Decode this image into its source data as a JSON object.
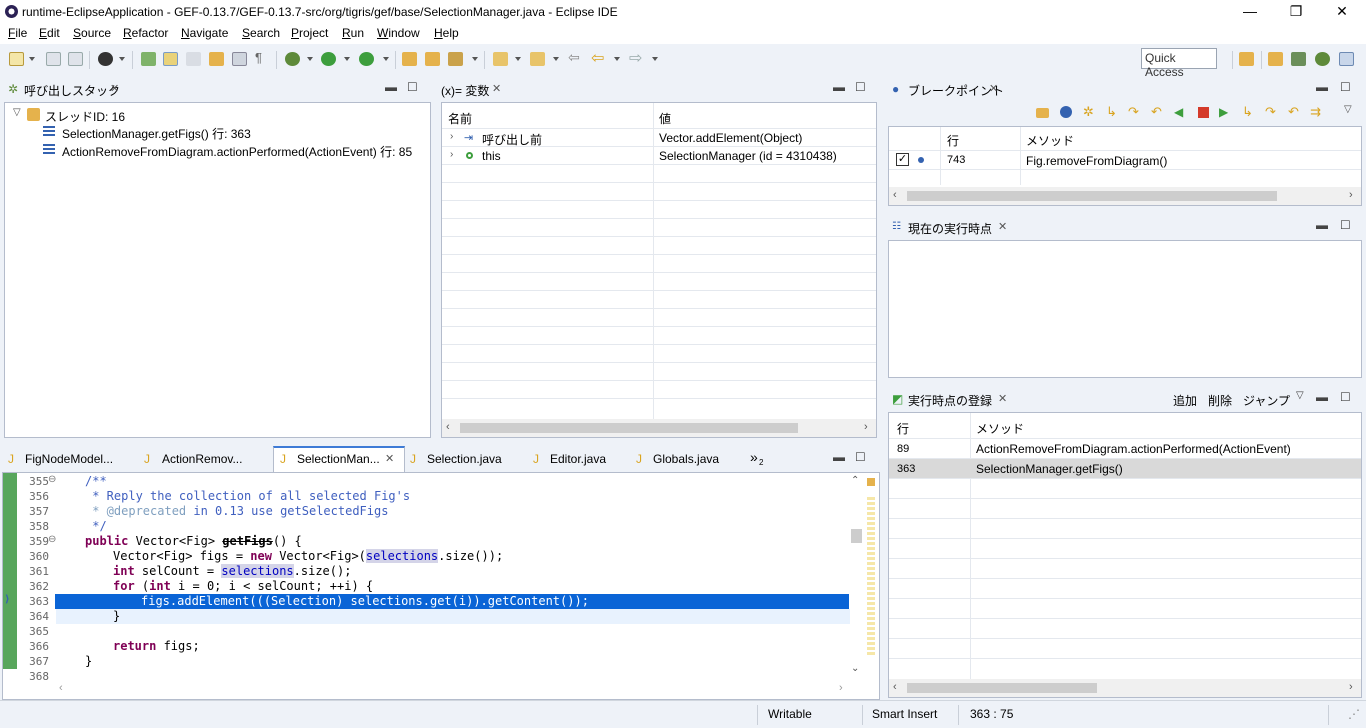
{
  "window": {
    "title": "runtime-EclipseApplication - GEF-0.13.7/GEF-0.13.7-src/org/tigris/gef/base/SelectionManager.java - Eclipse IDE",
    "minimize": "—",
    "restore": "❐",
    "close": "✕"
  },
  "menu": [
    "File",
    "Edit",
    "Source",
    "Refactor",
    "Navigate",
    "Search",
    "Project",
    "Run",
    "Window",
    "Help"
  ],
  "quick_access": "Quick Access",
  "callstack": {
    "tab": "呼び出しスタック",
    "thread": "スレッドID: 16",
    "frames": [
      "SelectionManager.getFigs() 行: 363",
      "ActionRemoveFromDiagram.actionPerformed(ActionEvent) 行: 85"
    ]
  },
  "variables": {
    "tab": "(x)= 変数",
    "col_name": "名前",
    "col_value": "値",
    "rows": [
      {
        "name": "呼び出し前",
        "value": "Vector.addElement(Object)"
      },
      {
        "name": "this",
        "value": "SelectionManager (id = 4310438)"
      }
    ]
  },
  "breakpoints": {
    "tab": "ブレークポイント",
    "col_line": "行",
    "col_method": "メソッド",
    "rows": [
      {
        "line": "743",
        "method": "Fig.removeFromDiagram()"
      }
    ]
  },
  "current_point": {
    "tab": "現在の実行時点"
  },
  "registered_points": {
    "tab": "実行時点の登録",
    "add": "追加",
    "delete": "削除",
    "jump": "ジャンプ",
    "col_line": "行",
    "col_method": "メソッド",
    "rows": [
      {
        "line": "89",
        "method": "ActionRemoveFromDiagram.actionPerformed(ActionEvent)"
      },
      {
        "line": "363",
        "method": "SelectionManager.getFigs()"
      }
    ]
  },
  "editor": {
    "tabs": [
      "FigNodeModel...",
      "ActionRemov...",
      "SelectionMan...",
      "Selection.java",
      "Editor.java",
      "Globals.java"
    ],
    "overflow": "»",
    "overflow_count": "2",
    "line_numbers": [
      "355",
      "356",
      "357",
      "358",
      "359",
      "360",
      "361",
      "362",
      "363",
      "364",
      "365",
      "366",
      "367",
      "368"
    ],
    "fold_markers": [
      "⊖",
      "⊖"
    ],
    "code": {
      "l355": "/**",
      "l356": " * Reply the collection of all selected Fig's",
      "l357_tag": " * @deprecated",
      "l357_rest": " in 0.13 use getSelectedFigs",
      "l358": " */",
      "l359_kw": "public",
      "l359_a": " Vector<Fig> ",
      "l359_method": "getFigs",
      "l359_b": "() {",
      "l360_a": "Vector<Fig> figs = ",
      "l360_kw": "new",
      "l360_b": " Vector<Fig>(",
      "l360_sel": "selections",
      "l360_c": ".size());",
      "l361_kw": "int",
      "l361_a": " selCount = ",
      "l361_sel": "selections",
      "l361_b": ".size();",
      "l362_kw1": "for",
      "l362_a": " (",
      "l362_kw2": "int",
      "l362_b": " i = 0; i < selCount; ++i) {",
      "l363": "figs.addElement(((Selection) selections.get(i)).getContent());",
      "l364": "}",
      "l366_kw": "return",
      "l366_a": " figs;",
      "l367": "}"
    }
  },
  "status": {
    "writable": "Writable",
    "insert": "Smart Insert",
    "position": "363 : 75"
  },
  "colors": {
    "accent": "#0a64d6",
    "current_line": "#0a64d6",
    "keyword": "#7f0055",
    "comment": "#3f5fbf",
    "debug_green": "#3d9e3d"
  }
}
